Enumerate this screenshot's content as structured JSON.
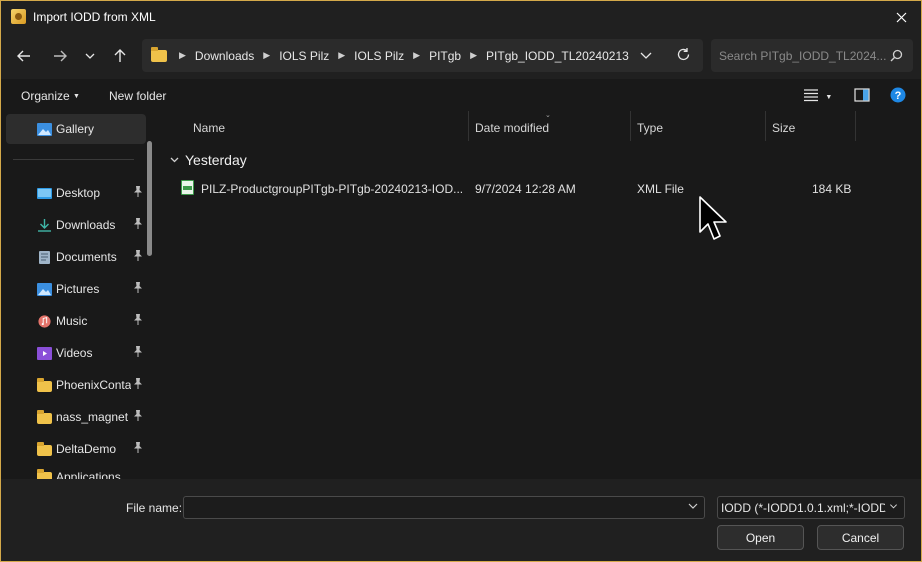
{
  "window": {
    "title": "Import IODD from XML"
  },
  "breadcrumb": [
    "Downloads",
    "IOLS Pilz",
    "IOLS Pilz",
    "PITgb",
    "PITgb_IODD_TL20240213"
  ],
  "search": {
    "placeholder": "Search PITgb_IODD_TL2024..."
  },
  "commands": {
    "organize": "Organize",
    "new_folder": "New folder"
  },
  "sidebar": {
    "items": [
      {
        "label": "Gallery"
      },
      {
        "label": "Desktop"
      },
      {
        "label": "Downloads"
      },
      {
        "label": "Documents"
      },
      {
        "label": "Pictures"
      },
      {
        "label": "Music"
      },
      {
        "label": "Videos"
      },
      {
        "label": "PhoenixConta"
      },
      {
        "label": "nass_magnet"
      },
      {
        "label": "DeltaDemo"
      },
      {
        "label": "Applications"
      }
    ]
  },
  "columns": {
    "name": "Name",
    "date": "Date modified",
    "type": "Type",
    "size": "Size"
  },
  "group": {
    "label": "Yesterday"
  },
  "files": [
    {
      "name": "PILZ-ProductgroupPITgb-PITgb-20240213-IOD...",
      "date": "9/7/2024 12:28 AM",
      "type": "XML File",
      "size": "184 KB"
    }
  ],
  "footer": {
    "file_name_label": "File name:",
    "file_type": "IODD (*-IODD1.0.1.xml;*-IODD",
    "open": "Open",
    "cancel": "Cancel"
  },
  "colors": {
    "accent_border": "#d4a94a",
    "help": "#1e88e5"
  }
}
